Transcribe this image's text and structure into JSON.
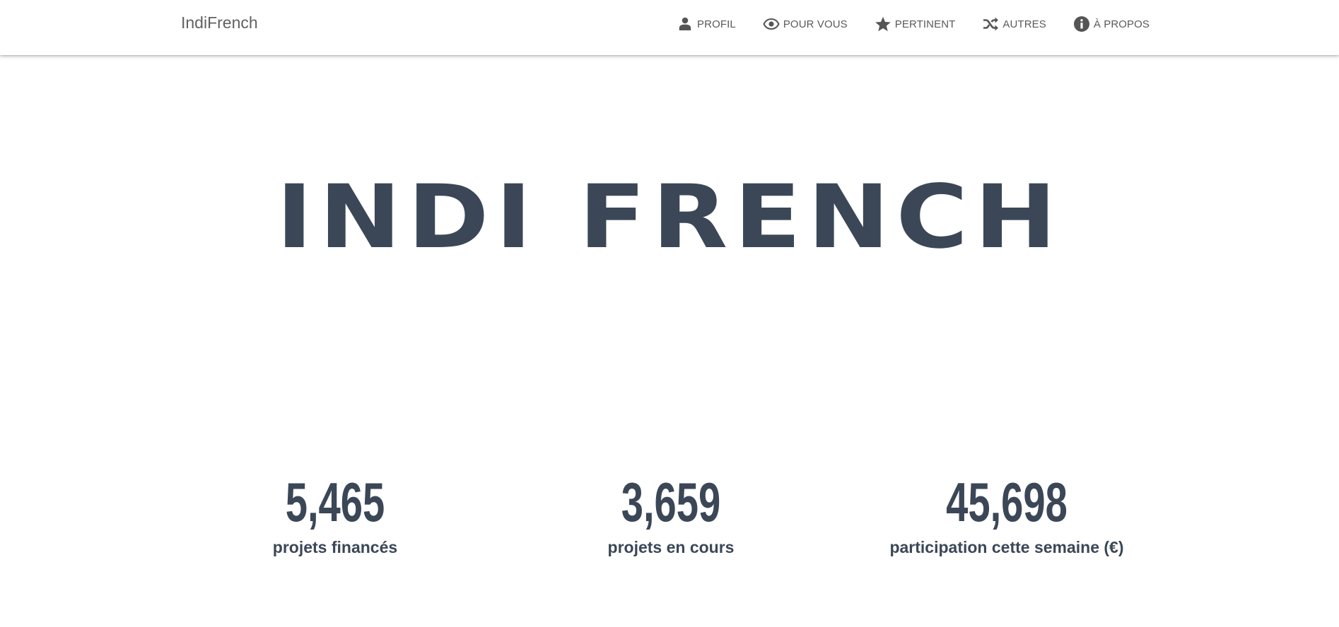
{
  "brand": "IndiFrench",
  "nav": {
    "items": [
      {
        "label": "PROFIL",
        "icon": "person-icon"
      },
      {
        "label": "POUR VOUS",
        "icon": "eye-icon"
      },
      {
        "label": "PERTINENT",
        "icon": "star-icon"
      },
      {
        "label": "AUTRES",
        "icon": "shuffle-icon"
      },
      {
        "label": "À PROPOS",
        "icon": "info-icon"
      }
    ]
  },
  "hero": {
    "title": "INDI FRENCH"
  },
  "stats": [
    {
      "value": "5,465",
      "label": "projets financés"
    },
    {
      "value": "3,659",
      "label": "projets en cours"
    },
    {
      "value": "45,698",
      "label": "participation cette semaine (€)"
    }
  ],
  "colors": {
    "text_dark": "#3b4757",
    "nav_text": "#5a5a5a",
    "brand_text": "#616161",
    "background": "#ffffff"
  }
}
